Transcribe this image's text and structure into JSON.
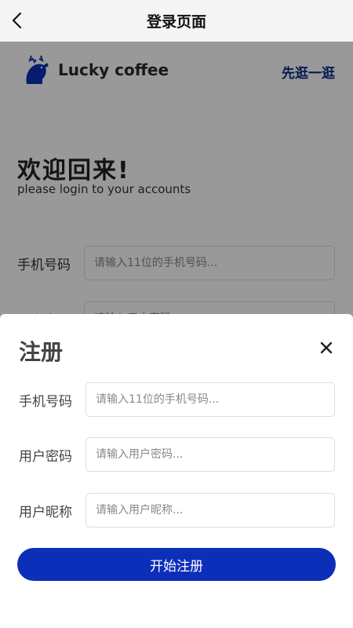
{
  "navbar": {
    "title": "登录页面",
    "back_icon": "chevron-left-icon"
  },
  "login_page": {
    "brand_name": "Lucky coffee",
    "logo_icon": "deer-logo",
    "browse_link": "先逛一逛",
    "welcome_title": "欢迎回来!",
    "welcome_subtitle": "please login to your accounts",
    "phone_label": "手机号码",
    "phone_placeholder": "请输入11位的手机号码...",
    "password_label": "用户密码",
    "password_placeholder": "请输入用户密码..."
  },
  "register_sheet": {
    "title": "注册",
    "close_icon": "close-icon",
    "fields": [
      {
        "label": "手机号码",
        "placeholder": "请输入11位的手机号码..."
      },
      {
        "label": "用户密码",
        "placeholder": "请输入用户密码..."
      },
      {
        "label": "用户昵称",
        "placeholder": "请输入用户昵称..."
      }
    ],
    "submit_label": "开始注册"
  },
  "colors": {
    "accent": "#0c2fb9",
    "link": "#0b2a8a",
    "overlay": "rgba(0,0,0,0.4)"
  }
}
